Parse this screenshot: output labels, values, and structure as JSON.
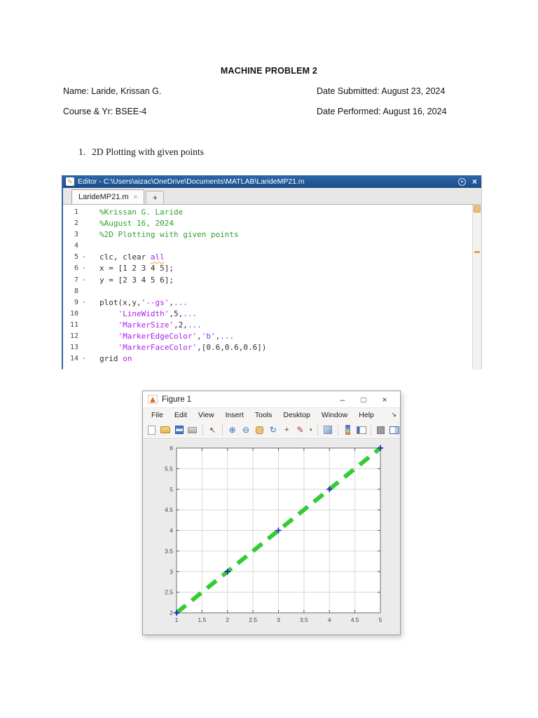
{
  "document": {
    "title": "MACHINE PROBLEM 2",
    "name_line": "Name: Laride, Krissan G.",
    "course_line": "Course & Yr: BSEE-4",
    "date_submitted": "Date Submitted: August 23, 2024",
    "date_performed": "Date Performed: August 16, 2024",
    "item_number": "1.",
    "item_title": "2D Plotting with given points"
  },
  "editor": {
    "title": "Editor - C:\\Users\\aizac\\OneDrive\\Documents\\MATLAB\\LarideMP21.m",
    "tab_label": "LarideMP21.m",
    "new_tab_label": "+",
    "code_lines": [
      {
        "n": "1",
        "exec": false,
        "seg": [
          [
            "%Krissan G. Laride",
            "c"
          ]
        ]
      },
      {
        "n": "2",
        "exec": false,
        "seg": [
          [
            "%August 16, 2024",
            "c"
          ]
        ]
      },
      {
        "n": "3",
        "exec": false,
        "seg": [
          [
            "%2D Plotting with given points",
            "c"
          ]
        ]
      },
      {
        "n": "4",
        "exec": false,
        "seg": []
      },
      {
        "n": "5",
        "exec": true,
        "seg": [
          [
            "clc, clear ",
            "t"
          ],
          [
            "all",
            "w"
          ]
        ]
      },
      {
        "n": "6",
        "exec": true,
        "seg": [
          [
            "x = [1 2 3 4 5];",
            "t"
          ]
        ]
      },
      {
        "n": "7",
        "exec": true,
        "seg": [
          [
            "y = [2 3 4 5 6];",
            "t"
          ]
        ]
      },
      {
        "n": "8",
        "exec": false,
        "seg": []
      },
      {
        "n": "9",
        "exec": true,
        "seg": [
          [
            "plot(x,y,",
            "t"
          ],
          [
            "'--gs'",
            "s"
          ],
          [
            ",",
            "t"
          ],
          [
            "...",
            "e"
          ]
        ]
      },
      {
        "n": "10",
        "exec": false,
        "seg": [
          [
            "    ",
            "t"
          ],
          [
            "'LineWidth'",
            "s"
          ],
          [
            ",5,",
            "t"
          ],
          [
            "...",
            "e"
          ]
        ]
      },
      {
        "n": "11",
        "exec": false,
        "seg": [
          [
            "    ",
            "t"
          ],
          [
            "'MarkerSize'",
            "s"
          ],
          [
            ",2,",
            "t"
          ],
          [
            "...",
            "e"
          ]
        ]
      },
      {
        "n": "12",
        "exec": false,
        "seg": [
          [
            "    ",
            "t"
          ],
          [
            "'MarkerEdgeColor'",
            "s"
          ],
          [
            ",",
            "t"
          ],
          [
            "'b'",
            "s"
          ],
          [
            ",",
            "t"
          ],
          [
            "...",
            "e"
          ]
        ]
      },
      {
        "n": "13",
        "exec": false,
        "seg": [
          [
            "    ",
            "t"
          ],
          [
            "'MarkerFaceColor'",
            "s"
          ],
          [
            ",[0.6,0.6,0.6])",
            "t"
          ]
        ]
      },
      {
        "n": "14",
        "exec": true,
        "seg": [
          [
            "grid ",
            "t"
          ],
          [
            "on",
            "k"
          ]
        ]
      }
    ]
  },
  "figure_window": {
    "title": "Figure 1",
    "menu": [
      "File",
      "Edit",
      "View",
      "Insert",
      "Tools",
      "Desktop",
      "Window",
      "Help"
    ],
    "toolbar_icons": [
      "new-document",
      "open-folder",
      "save",
      "print",
      "pointer",
      "zoom-in",
      "zoom-out",
      "pan",
      "rotate-3d",
      "data-cursor",
      "brush",
      "link-plots",
      "insert-colorbar",
      "insert-legend",
      "hide-plot-tools",
      "show-plot-tools"
    ]
  },
  "icons": {
    "editor_pencil": "✎",
    "editor_menu": "▾",
    "editor_close": "×",
    "tab_close": "×",
    "minimize": "–",
    "maximize": "□",
    "close": "×",
    "menu_overflow": "↘",
    "pointer": "↖",
    "zoom_in": "⊕",
    "zoom_out": "⊖",
    "rotate": "↻",
    "data_cursor": "+",
    "brush": "✎",
    "brush_dropdown": "▾"
  },
  "colors": {
    "editor_titlebar": "#1d4f8c",
    "comment_green": "#2f9e2f",
    "string_purple": "#aa22ee",
    "continuation_blue": "#4d4dee",
    "warning_orange": "#e8a43c",
    "plot_line_green": "#33cc33",
    "marker_blue": "#2323cc"
  },
  "chart_data": {
    "type": "line",
    "title": "",
    "xlabel": "",
    "ylabel": "",
    "x": [
      1,
      2,
      3,
      4,
      5
    ],
    "y": [
      2,
      3,
      4,
      5,
      6
    ],
    "xlim": [
      1,
      5
    ],
    "ylim": [
      2,
      6
    ],
    "xticks": [
      1,
      1.5,
      2,
      2.5,
      3,
      3.5,
      4,
      4.5,
      5
    ],
    "xtick_labels": [
      "1",
      "1.5",
      "2",
      "2.5",
      "3",
      "3.5",
      "4",
      "4.5",
      "5"
    ],
    "yticks": [
      2,
      2.5,
      3,
      3.5,
      4,
      4.5,
      5,
      5.5,
      6
    ],
    "ytick_labels": [
      "2",
      "2.5",
      "3",
      "3.5",
      "4",
      "4.5",
      "5",
      "5.5",
      "6"
    ],
    "grid": true,
    "line_style": "--",
    "line_color": "#33cc33",
    "line_width": 6,
    "marker": "+",
    "marker_color": "#2323cc",
    "marker_size": 4
  }
}
